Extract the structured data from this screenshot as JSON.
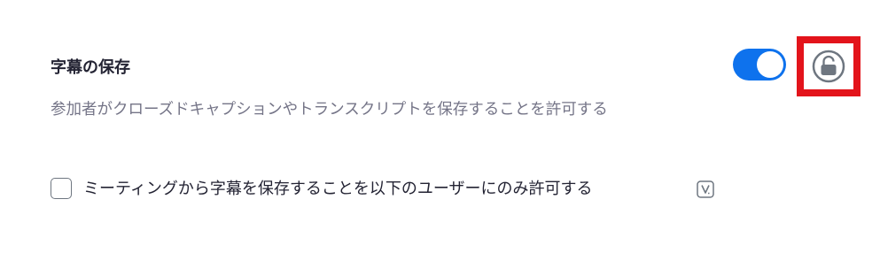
{
  "setting": {
    "title": "字幕の保存",
    "description": "参加者がクローズドキャプションやトランスクリプトを保存することを許可する",
    "toggle_state": "on",
    "lock_state": "unlocked"
  },
  "option": {
    "checkbox_label": "ミーティングから字幕を保存することを以下のユーザーにのみ許可する",
    "checked": false,
    "badge_icon": "v-badge-icon"
  },
  "colors": {
    "toggle_on": "#0e72ed",
    "highlight": "#e3141b",
    "title_text": "#232333",
    "description_text": "#747487",
    "icon_gray": "#6e7680"
  }
}
